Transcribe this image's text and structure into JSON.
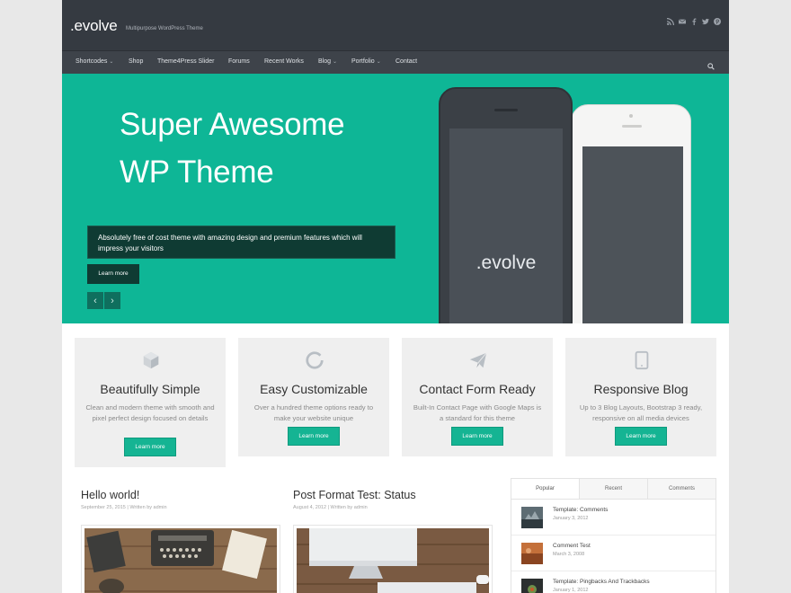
{
  "site": {
    "title": ".evolve",
    "tagline": "Multipurpose WordPress Theme",
    "social_icons": [
      "rss-icon",
      "email-icon",
      "facebook-icon",
      "twitter-icon",
      "pinterest-icon"
    ]
  },
  "nav": {
    "items": [
      {
        "label": "Shortcodes",
        "dropdown": true
      },
      {
        "label": "Shop",
        "dropdown": false
      },
      {
        "label": "Theme4Press Slider",
        "dropdown": false
      },
      {
        "label": "Forums",
        "dropdown": false
      },
      {
        "label": "Recent Works",
        "dropdown": false
      },
      {
        "label": "Blog",
        "dropdown": true
      },
      {
        "label": "Portfolio",
        "dropdown": true
      },
      {
        "label": "Contact",
        "dropdown": false
      }
    ],
    "caret": "⌄"
  },
  "hero": {
    "title_line1": "Super Awesome",
    "title_line2": "WP Theme",
    "description": "Absolutely free of cost theme with amazing design and premium features which will impress your visitors",
    "button": "Learn more",
    "prev": "‹",
    "next": "›",
    "phone_text": ".evolve",
    "bg_color": "#0eb696"
  },
  "features": [
    {
      "icon": "cube-icon",
      "title": "Beautifully Simple",
      "text": "Clean and modern theme with smooth and pixel perfect design focused on details",
      "button": "Learn more"
    },
    {
      "icon": "circle-notch-icon",
      "title": "Easy Customizable",
      "text": "Over a hundred theme options ready to make your website unique",
      "button": "Learn more"
    },
    {
      "icon": "paper-plane-icon",
      "title": "Contact Form Ready",
      "text": "Built-In Contact Page with Google Maps is a standard for this theme",
      "button": "Learn more"
    },
    {
      "icon": "tablet-icon",
      "title": "Responsive Blog",
      "text": "Up to 3 Blog Layouts, Bootstrap 3 ready, responsive on all media devices",
      "button": "Learn more"
    }
  ],
  "posts": [
    {
      "title": "Hello world!",
      "date": "September 25, 2015",
      "sep": "|",
      "author_prefix": "Written by",
      "author": "admin"
    },
    {
      "title": "Post Format Test: Status",
      "date": "August 4, 2012",
      "sep": "|",
      "author_prefix": "Written by",
      "author": "admin"
    }
  ],
  "sidebar": {
    "tabs": [
      "Popular",
      "Recent",
      "Comments"
    ],
    "items": [
      {
        "title": "Template: Comments",
        "date": "January 3, 2012"
      },
      {
        "title": "Comment Test",
        "date": "March 3, 2008"
      },
      {
        "title": "Template: Pingbacks And Trackbacks",
        "date": "January 1, 2012"
      }
    ]
  },
  "colors": {
    "accent": "#15b493",
    "header": "#353a41",
    "nav": "#3e434a"
  }
}
